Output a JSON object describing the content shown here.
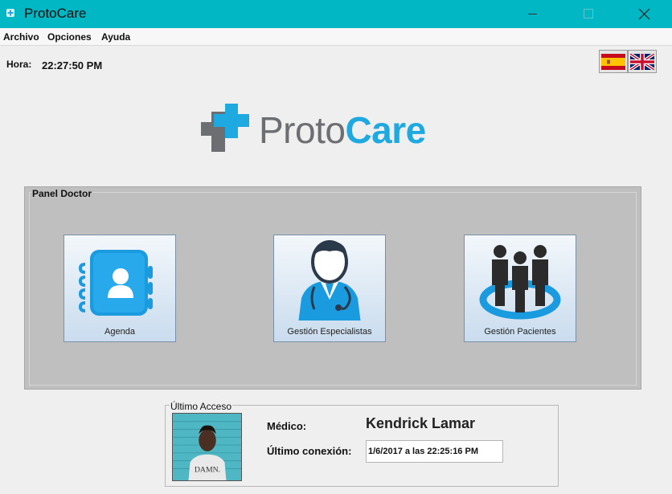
{
  "window": {
    "title": "ProtoCare",
    "accent_color": "#00b7c3",
    "controls": [
      "minimize-icon",
      "maximize-icon",
      "close-icon"
    ]
  },
  "menu": {
    "items": [
      "Archivo",
      "Opciones",
      "Ayuda"
    ]
  },
  "clock": {
    "label": "Hora:",
    "value": "22:27:50 PM"
  },
  "languages": {
    "flags": [
      "flag-spain-icon",
      "flag-uk-icon"
    ]
  },
  "logo": {
    "proto": "Proto",
    "care": "Care",
    "colors": {
      "gray": "#6d6e71",
      "blue": "#1fa9e1"
    }
  },
  "panel": {
    "title": "Panel Doctor",
    "tiles": [
      {
        "label": "Agenda",
        "icon": "address-book-icon"
      },
      {
        "label": "Gestión Especialistas",
        "icon": "doctor-icon"
      },
      {
        "label": "Gestión Pacientes",
        "icon": "people-group-icon"
      }
    ]
  },
  "last_access": {
    "title": "Último Acceso",
    "doctor_label": "Médico:",
    "doctor_name": "Kendrick Lamar",
    "connection_label": "Último conexión:",
    "connection_value": "1/6/2017 a las 22:25:16 PM",
    "photo_shirt_text": "DAMN."
  }
}
